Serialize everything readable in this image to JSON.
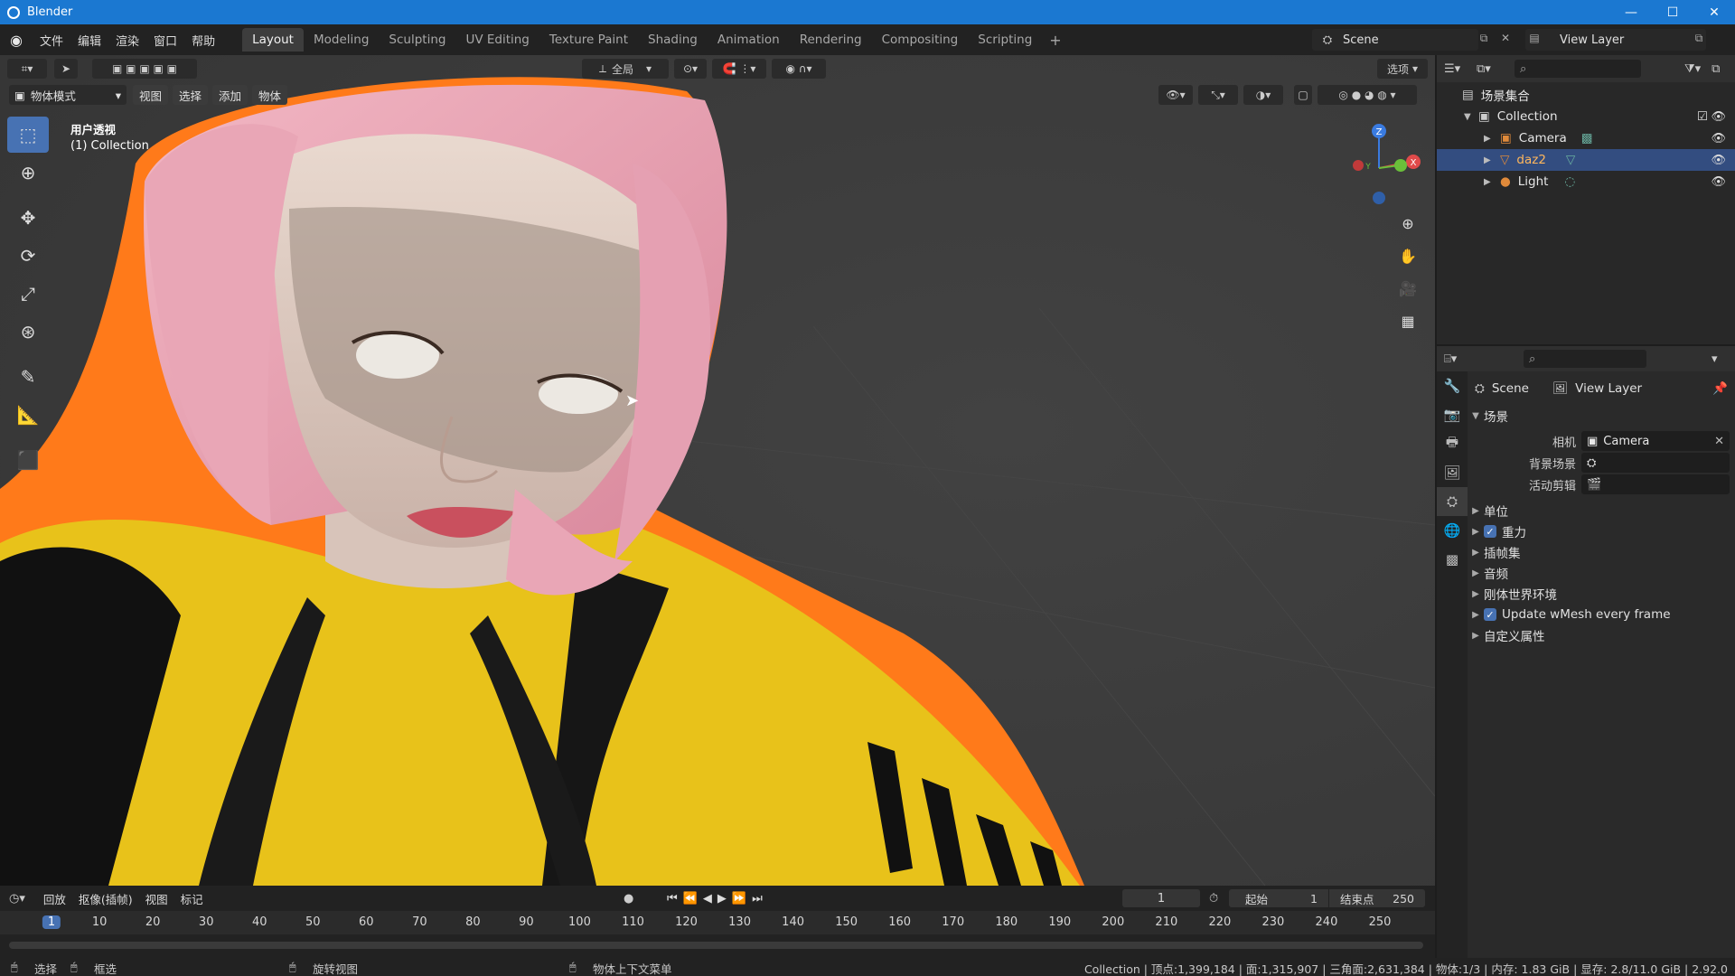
{
  "window": {
    "title": "Blender",
    "controls": [
      "—",
      "☐",
      "✕"
    ]
  },
  "menubar": {
    "menus": [
      "文件",
      "编辑",
      "渲染",
      "窗口",
      "帮助"
    ],
    "workspaces": [
      "Layout",
      "Modeling",
      "Sculpting",
      "UV Editing",
      "Texture Paint",
      "Shading",
      "Animation",
      "Rendering",
      "Compositing",
      "Scripting"
    ],
    "active_workspace": "Layout",
    "add_tab": "+",
    "scene": "Scene",
    "view_layer": "View Layer"
  },
  "viewport": {
    "header": {
      "transform_orientation": "全局",
      "options": "选项"
    },
    "mode": "物体模式",
    "menus": [
      "视图",
      "选择",
      "添加",
      "物体"
    ],
    "view_name": "用户透视",
    "collection_label": "(1) Collection",
    "gizmo": {
      "x": "X",
      "y": "Y",
      "z": "Z"
    },
    "colors": {
      "background": "#393939",
      "selection_outline": "#ff7a1a",
      "suit": "#e8c21a",
      "hair": "#e8a0b0"
    }
  },
  "outliner": {
    "root": "场景集合",
    "collection": "Collection",
    "items": [
      {
        "name": "Camera",
        "icon": "camera-icon",
        "selected": false
      },
      {
        "name": "daz2",
        "icon": "mesh-icon",
        "selected": true
      },
      {
        "name": "Light",
        "icon": "light-icon",
        "selected": false
      }
    ]
  },
  "properties": {
    "tabs": [
      "Scene",
      "View Layer"
    ],
    "panel_title": "场景",
    "camera_label": "相机",
    "camera_value": "Camera",
    "background_scene_label": "背景场景",
    "active_clip_label": "活动剪辑",
    "sections": [
      {
        "label": "单位",
        "checkbox": false
      },
      {
        "label": "重力",
        "checkbox": true
      },
      {
        "label": "插帧集",
        "checkbox": false
      },
      {
        "label": "音频",
        "checkbox": false
      },
      {
        "label": "刚体世界环境",
        "checkbox": false
      },
      {
        "label": "Update wMesh every frame",
        "checkbox": true
      },
      {
        "label": "自定义属性",
        "checkbox": false
      }
    ]
  },
  "timeline": {
    "menus": [
      "回放",
      "抠像(插帧)",
      "视图",
      "标记"
    ],
    "current_frame": "1",
    "start_label": "起始",
    "start_value": "1",
    "end_label": "结束点",
    "end_value": "250",
    "ticks": [
      "1",
      "10",
      "20",
      "30",
      "40",
      "50",
      "60",
      "70",
      "80",
      "90",
      "100",
      "110",
      "120",
      "130",
      "140",
      "150",
      "160",
      "170",
      "180",
      "190",
      "200",
      "210",
      "220",
      "230",
      "240",
      "250"
    ]
  },
  "statusbar": {
    "select": "选择",
    "box_select": "框选",
    "rotate_view": "旋转视图",
    "context_menu": "物体上下文菜单",
    "stats": "Collection | 顶点:1,399,184 | 面:1,315,907 | 三角面:2,631,384 | 物体:1/3 | 内存: 1.83 GiB | 显存: 2.8/11.0 GiB | 2.92.0"
  }
}
